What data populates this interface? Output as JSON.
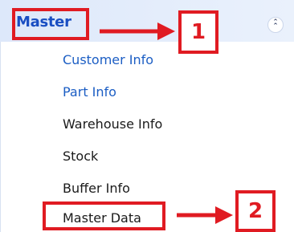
{
  "panel": {
    "title": "Master",
    "collapse_icon": "double-chevron-up-icon",
    "header_color": "#dde8fa",
    "title_color": "#1a4ec2"
  },
  "menu": {
    "items": [
      {
        "label": "Customer Info",
        "color": "#1c5ec4"
      },
      {
        "label": "Part Info",
        "color": "#1c5ec4"
      },
      {
        "label": "Warehouse Info",
        "color": "#1a1a1a"
      },
      {
        "label": "Stock",
        "color": "#1a1a1a"
      },
      {
        "label": "Buffer Info",
        "color": "#1a1a1a"
      },
      {
        "label": "Master Data",
        "color": "#1a1a1a"
      }
    ]
  },
  "annotations": {
    "color": "#e01b22",
    "callouts": [
      {
        "number": "1"
      },
      {
        "number": "2"
      }
    ]
  }
}
